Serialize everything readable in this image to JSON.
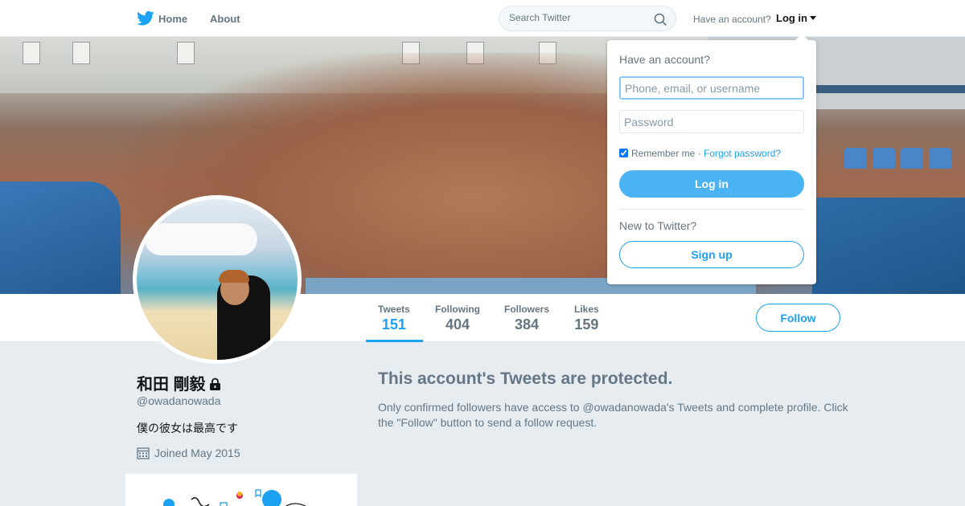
{
  "nav": {
    "home_label": "Home",
    "about_label": "About",
    "search_placeholder": "Search Twitter",
    "have_account": "Have an account?",
    "login_label": "Log in"
  },
  "profile": {
    "name": "和田 剛毅",
    "handle": "@owadanowada",
    "bio": "僕の彼女は最高です",
    "joined": "Joined May 2015",
    "protected": true
  },
  "stats": [
    {
      "label": "Tweets",
      "value": "151",
      "active": true
    },
    {
      "label": "Following",
      "value": "404",
      "active": false
    },
    {
      "label": "Followers",
      "value": "384",
      "active": false
    },
    {
      "label": "Likes",
      "value": "159",
      "active": false
    }
  ],
  "follow_label": "Follow",
  "protected_notice": {
    "title": "This account's Tweets are protected.",
    "body": "Only confirmed followers have access to @owadanowada's Tweets and complete profile. Click the \"Follow\" button to send a follow request."
  },
  "login_dropdown": {
    "title": "Have an account?",
    "username_placeholder": "Phone, email, or username",
    "password_placeholder": "Password",
    "remember_label": "Remember me",
    "separator": " · ",
    "forgot_label": "Forgot password?",
    "login_button": "Log in",
    "new_prompt": "New to Twitter?",
    "signup_button": "Sign up"
  },
  "colors": {
    "accent": "#1da1f2",
    "login_button_bg": "#4ab3f4",
    "page_bg": "#e6ecf0",
    "muted_text": "#657786"
  },
  "icons": [
    "twitter-bird-icon",
    "search-icon",
    "caret-down-icon",
    "lock-icon",
    "calendar-icon"
  ]
}
